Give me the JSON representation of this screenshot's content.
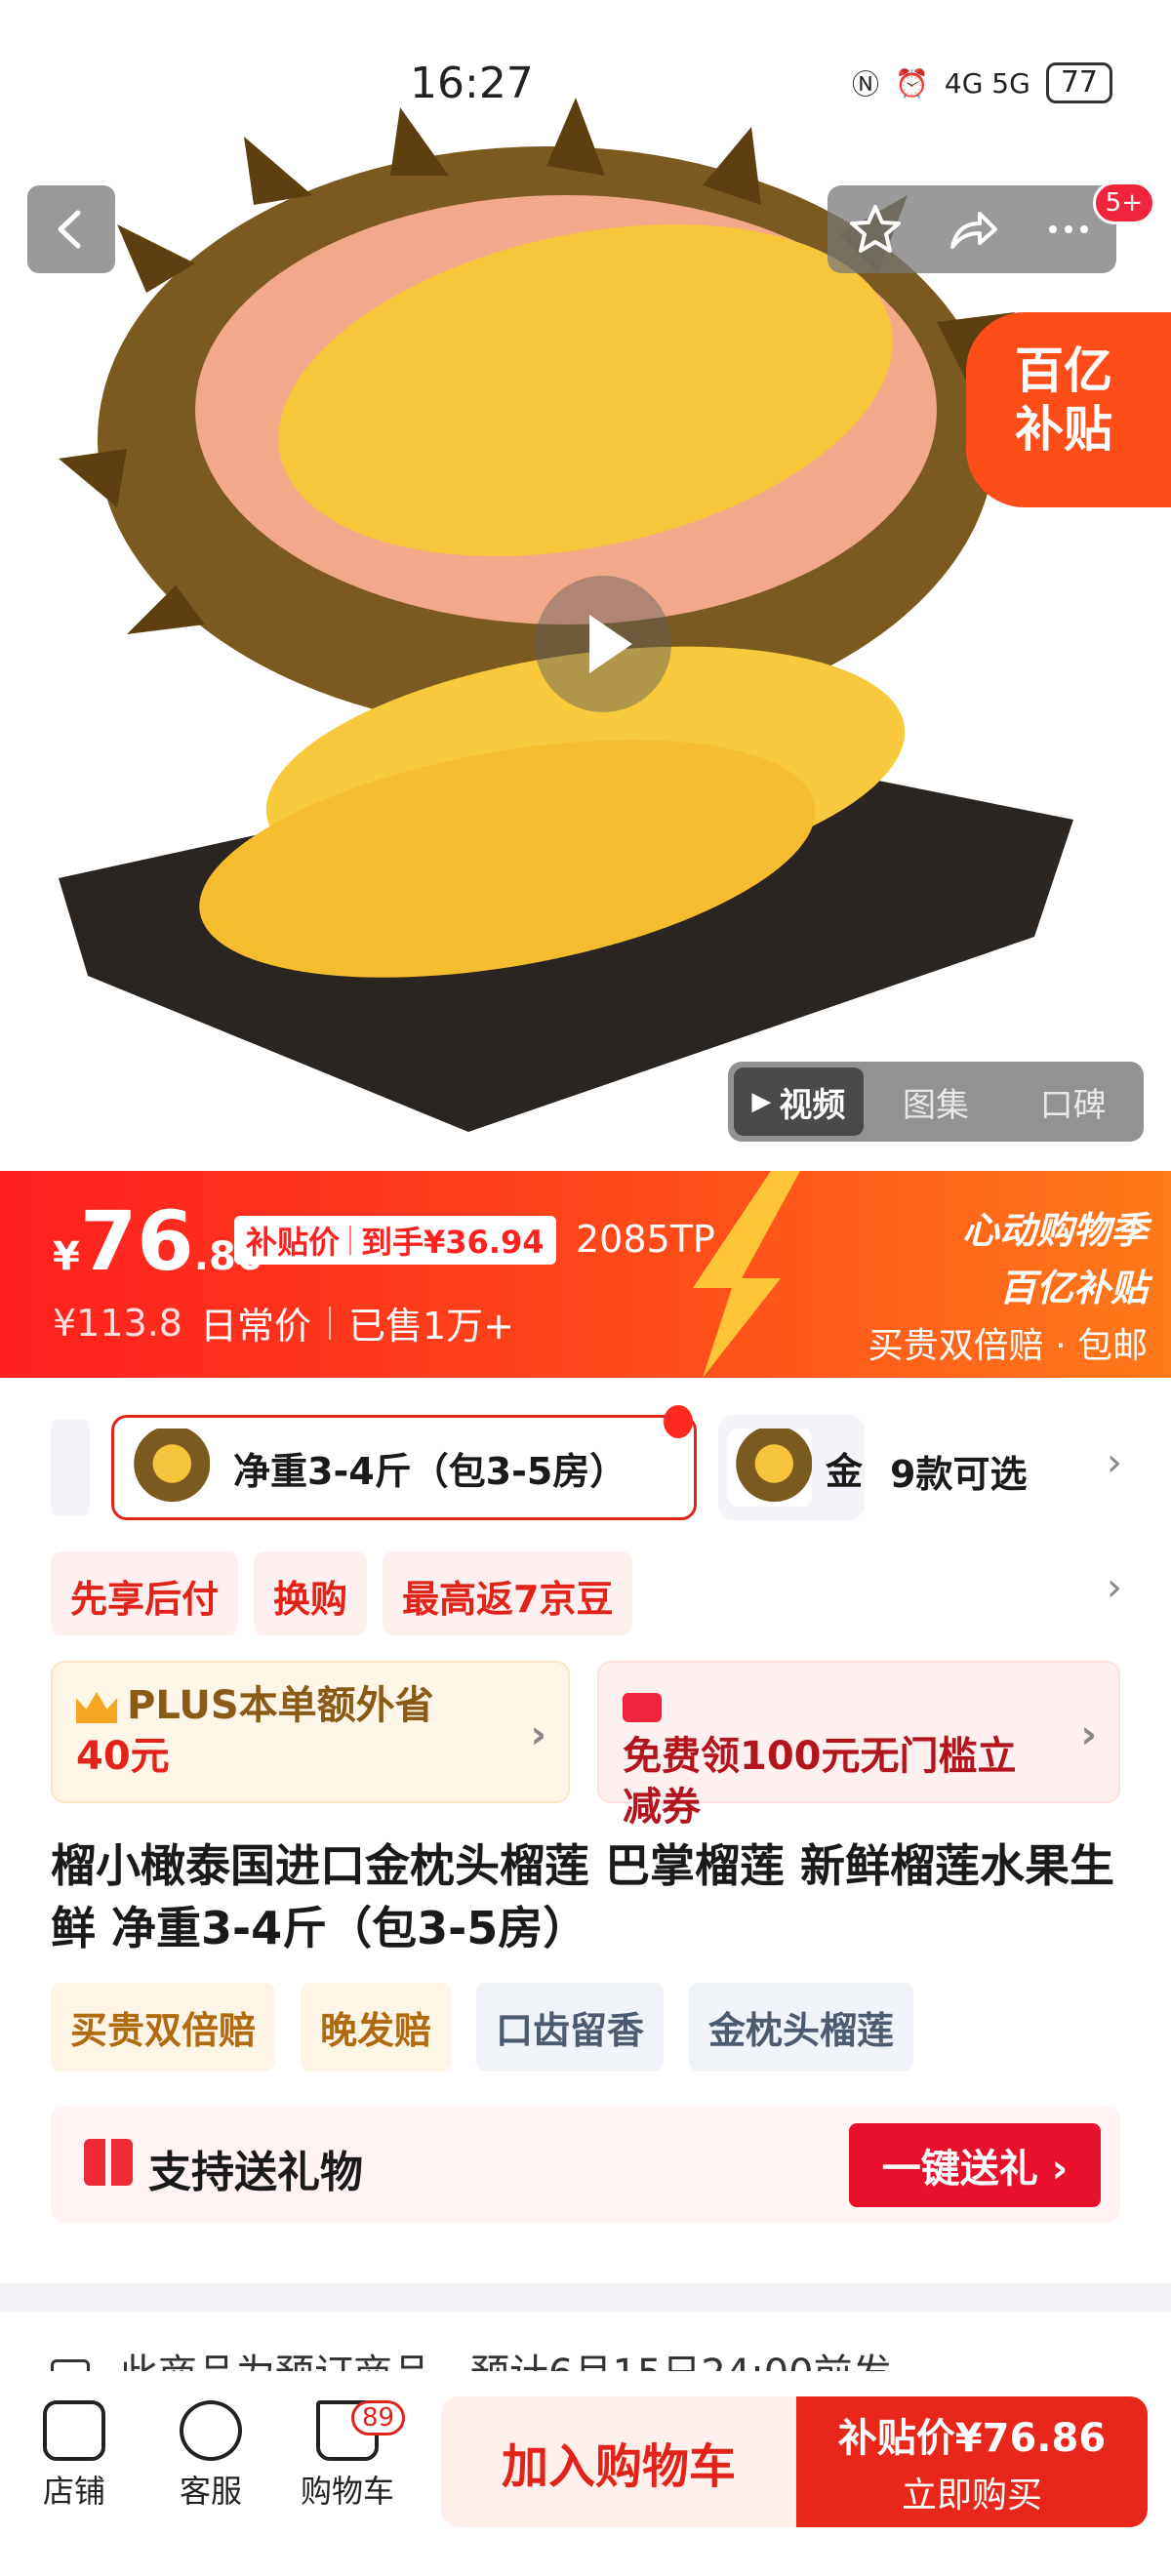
{
  "status_bar": {
    "time": "16:27",
    "network": "4G 5G",
    "battery": "77"
  },
  "header": {
    "notification_count": "5+"
  },
  "promo_corner": {
    "line1": "百亿",
    "line2": "补贴"
  },
  "media_tabs": [
    "视频",
    "图集",
    "口碑"
  ],
  "price": {
    "yen": "¥",
    "integer": "76",
    "decimal": ".86",
    "tag_label": "补贴价",
    "tag_extra": "到手¥36.94",
    "code": "2085TP",
    "original": "¥113.8",
    "original_label": "日常价",
    "sold": "已售1万+"
  },
  "promo_right": {
    "line1": "心动购物季",
    "line2": "百亿补贴",
    "line3": "买贵双倍赔 · 包邮"
  },
  "sku": {
    "selected": "净重3-4斤（包3-5房）",
    "second": "金",
    "count": "9款可选"
  },
  "services": [
    "先享后付",
    "换购",
    "最高返7京豆"
  ],
  "coupons": {
    "plus_text": "PLUS本单额外省",
    "plus_amount": "40元",
    "free_text": "免费领100元无门槛立减券"
  },
  "title": "榴小橄泰国进口金枕头榴莲 巴掌榴莲 新鲜榴莲水果生鲜 净重3-4斤（包3-5房）",
  "features": [
    "买贵双倍赔",
    "晚发赔",
    "口齿留香",
    "金枕头榴莲"
  ],
  "gift": {
    "label": "支持送礼物",
    "button": "一键送礼 ›"
  },
  "preorder": "此商品为预订商品，预计6月15日24:00前发",
  "bottom_nav": {
    "store": "店铺",
    "service": "客服",
    "cart": "购物车",
    "cart_count": "89"
  },
  "actions": {
    "add_cart": "加入购物车",
    "buy_price": "补贴价¥76.86",
    "buy_now": "立即购买"
  },
  "colors": {
    "brand_red": "#e8261a",
    "banner_orange": "#ff4a1a"
  }
}
